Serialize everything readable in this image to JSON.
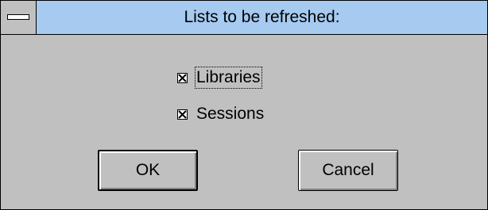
{
  "dialog": {
    "title": "Lists to be refreshed:",
    "system_menu_icon": "system-menu-icon"
  },
  "options": [
    {
      "label": "Libraries",
      "checked": true,
      "focused": true
    },
    {
      "label": "Sessions",
      "checked": true,
      "focused": false
    }
  ],
  "buttons": {
    "ok_label": "OK",
    "cancel_label": "Cancel"
  }
}
